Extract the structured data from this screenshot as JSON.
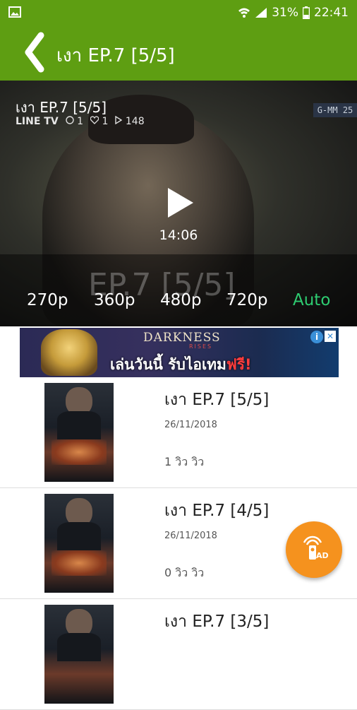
{
  "status_bar": {
    "battery": "31%",
    "time": "22:41",
    "icons": [
      "image-icon",
      "wifi-icon",
      "signal-icon",
      "battery-icon"
    ]
  },
  "toolbar": {
    "title": "เงา EP.7 [5/5]",
    "back_icon": "chevron-left-icon"
  },
  "player": {
    "title": "เงา EP.7 [5/5]",
    "brand": "LINE TV",
    "comments": "1",
    "likes": "1",
    "plays": "148",
    "duration": "14:06",
    "overlay_text": "EP.7 [5/5]",
    "channel_logo": "G-MM 25",
    "qualities": [
      "270p",
      "360p",
      "480p",
      "720p",
      "Auto"
    ],
    "selected_quality": "Auto",
    "accent_color": "#2ecc71"
  },
  "ad": {
    "title": "DARKNESS",
    "subtitle": "RISES",
    "promo_text": "เล่นวันนี้ รับไอเทม",
    "promo_highlight": "ฟรี!",
    "info_icon": "info-icon",
    "close_icon": "close-icon"
  },
  "episodes": [
    {
      "title": "เงา EP.7 [5/5]",
      "date": "26/11/2018",
      "views": "1 วิว วิว"
    },
    {
      "title": "เงา EP.7 [4/5]",
      "date": "26/11/2018",
      "views": "0 วิว วิว"
    },
    {
      "title": "เงา EP.7 [3/5]",
      "date": "",
      "views": ""
    }
  ],
  "fab": {
    "icon": "ad-broadcast-icon",
    "label": "AD"
  },
  "colors": {
    "brand_green": "#5e9e12",
    "fab_orange": "#f5921e"
  }
}
